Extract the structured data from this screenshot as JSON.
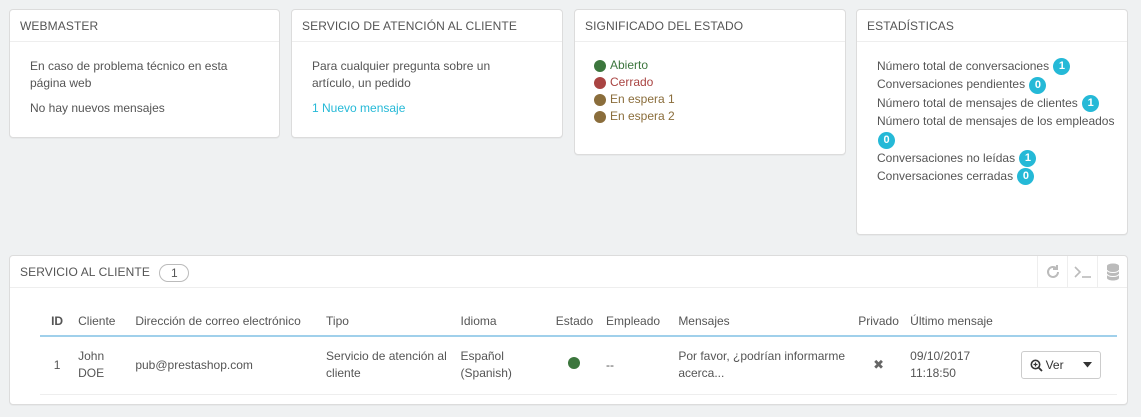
{
  "webmaster": {
    "title": "Webmaster",
    "line1": "En caso de problema técnico en esta página web",
    "line2": "No hay nuevos mensajes"
  },
  "customer_service": {
    "title": "Servicio de atención al cliente",
    "line1": "Para cualquier pregunta sobre un artículo, un pedido",
    "link": "1 Nuevo mensaje"
  },
  "status_meaning": {
    "title": "Significado del estado",
    "items": [
      {
        "label": "Abierto",
        "color": "#3c763d",
        "text_color": "#3c763d"
      },
      {
        "label": "Cerrado",
        "color": "#a94442",
        "text_color": "#a94442"
      },
      {
        "label": "En espera 1",
        "color": "#8a6d3b",
        "text_color": "#8a6d3b"
      },
      {
        "label": "En espera 2",
        "color": "#8a6d3b",
        "text_color": "#8a6d3b"
      }
    ]
  },
  "stats": {
    "title": "Estadísticas",
    "items": [
      {
        "label": "Número total de conversaciones",
        "value": "1"
      },
      {
        "label": "Conversaciones pendientes",
        "value": "0"
      },
      {
        "label": "Número total de mensajes de clientes",
        "value": "1"
      },
      {
        "label": "Número total de mensajes de los empleados",
        "value": "0"
      },
      {
        "label": "Conversaciones no leídas",
        "value": "1"
      },
      {
        "label": "Conversaciones cerradas",
        "value": "0"
      }
    ]
  },
  "list": {
    "title": "Servicio al cliente",
    "count": "1",
    "columns": [
      "ID",
      "Cliente",
      "Dirección de correo electrónico",
      "Tipo",
      "Idioma",
      "Estado",
      "Empleado",
      "Mensajes",
      "Privado",
      "Último mensaje"
    ],
    "rows": [
      {
        "id": "1",
        "client": "John DOE",
        "email": "pub@prestashop.com",
        "type": "Servicio de atención al cliente",
        "language": "Español (Spanish)",
        "status_color": "#3c763d",
        "employee": "--",
        "message": "Por favor, ¿podrían informarme acerca...",
        "private": "✖",
        "last_message": "09/10/2017 11:18:50",
        "action": "Ver"
      }
    ]
  },
  "colors": {
    "accent": "#25b9d7",
    "table_header_border": "#a0d0eb"
  }
}
